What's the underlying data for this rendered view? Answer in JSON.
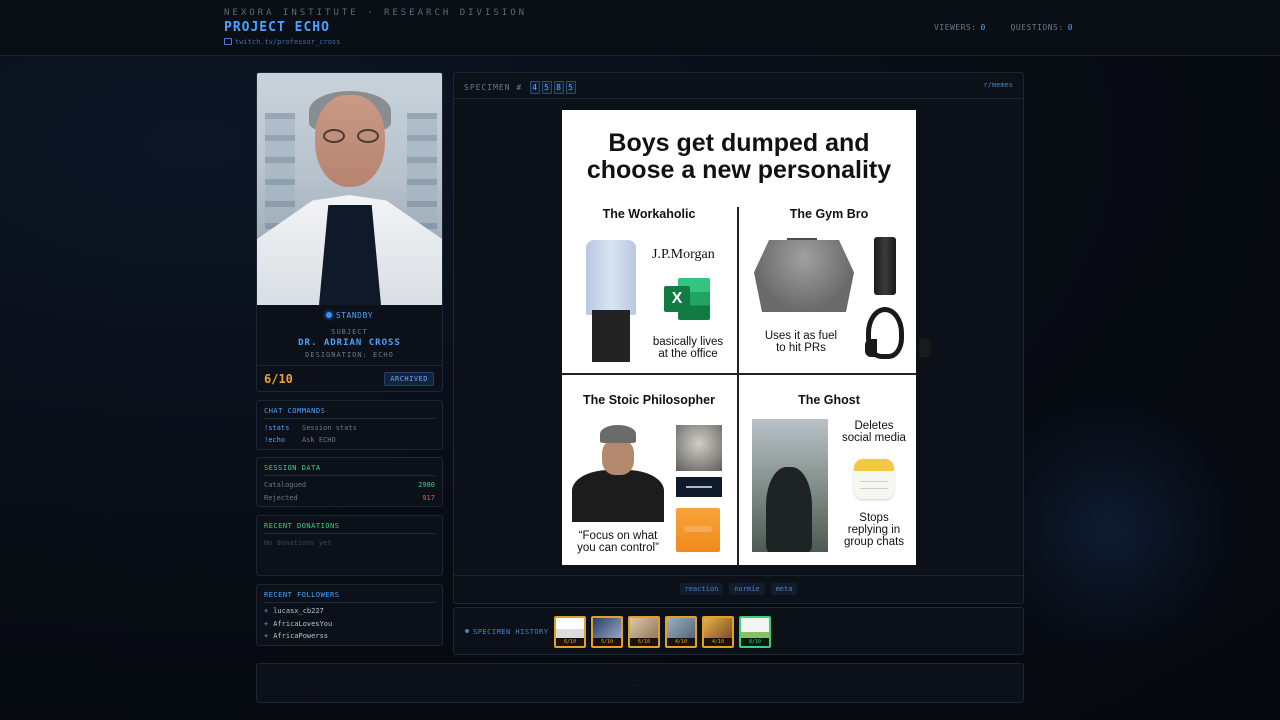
{
  "header": {
    "org": "NEXORA INSTITUTE · RESEARCH DIVISION",
    "project": "PROJECT ECHO",
    "twitch": "twitch.tv/professor_cross",
    "viewers_label": "VIEWERS:",
    "viewers": "0",
    "questions_label": "QUESTIONS:",
    "questions": "0"
  },
  "subject": {
    "status": "STANDBY",
    "label": "SUBJECT",
    "name": "DR. ADRIAN CROSS",
    "designation": "DESIGNATION: ECHO",
    "rating": "6/10",
    "badge": "ARCHIVED"
  },
  "commands": {
    "title": "CHAT COMMANDS",
    "items": [
      {
        "cmd": "!stats",
        "desc": "Session stats"
      },
      {
        "cmd": "!echo",
        "desc": "Ask ECHO"
      }
    ]
  },
  "session": {
    "title": "SESSION DATA",
    "catalogued_label": "Catalogued",
    "catalogued": "2980",
    "rejected_label": "Rejected",
    "rejected": "917"
  },
  "donations": {
    "title": "RECENT DONATIONS",
    "empty": "No donations yet"
  },
  "followers": {
    "title": "RECENT FOLLOWERS",
    "items": [
      "lucasx_cb227",
      "AfricaLovesYou",
      "AfricaPowerss"
    ]
  },
  "specimen": {
    "label": "SPECIMEN #",
    "digits": [
      "4",
      "5",
      "8",
      "5"
    ],
    "source": "r/memes",
    "tags": [
      "reaction",
      "normie",
      "meta"
    ]
  },
  "meme": {
    "title_line1": "Boys get dumped and",
    "title_line2": "choose a new personality",
    "q1_title": "The Workaholic",
    "q1_brand": "J.P.Morgan",
    "q1_caption_1": "basically lives",
    "q1_caption_2": "at the office",
    "q2_title": "The Gym Bro",
    "q2_caption_1": "Uses it as fuel",
    "q2_caption_2": "to hit PRs",
    "q3_title": "The Stoic Philosopher",
    "q3_caption_1": "“Focus on what",
    "q3_caption_2": "you can control”",
    "q4_title": "The Ghost",
    "q4_caption_a1": "Deletes",
    "q4_caption_a2": "social media",
    "q4_caption_b1": "Stops",
    "q4_caption_b2": "replying in",
    "q4_caption_b3": "group chats"
  },
  "history": {
    "label": "SPECIMEN HISTORY",
    "thumbs": [
      "6/10",
      "5/10",
      "6/10",
      "4/10",
      "4/10",
      "8/10"
    ]
  },
  "footer": {
    "dots": "..."
  },
  "colors": {
    "accent": "#4aa3ff",
    "rating": "#f0a030",
    "green": "#3ccf7a",
    "red": "#ff4d5e"
  }
}
